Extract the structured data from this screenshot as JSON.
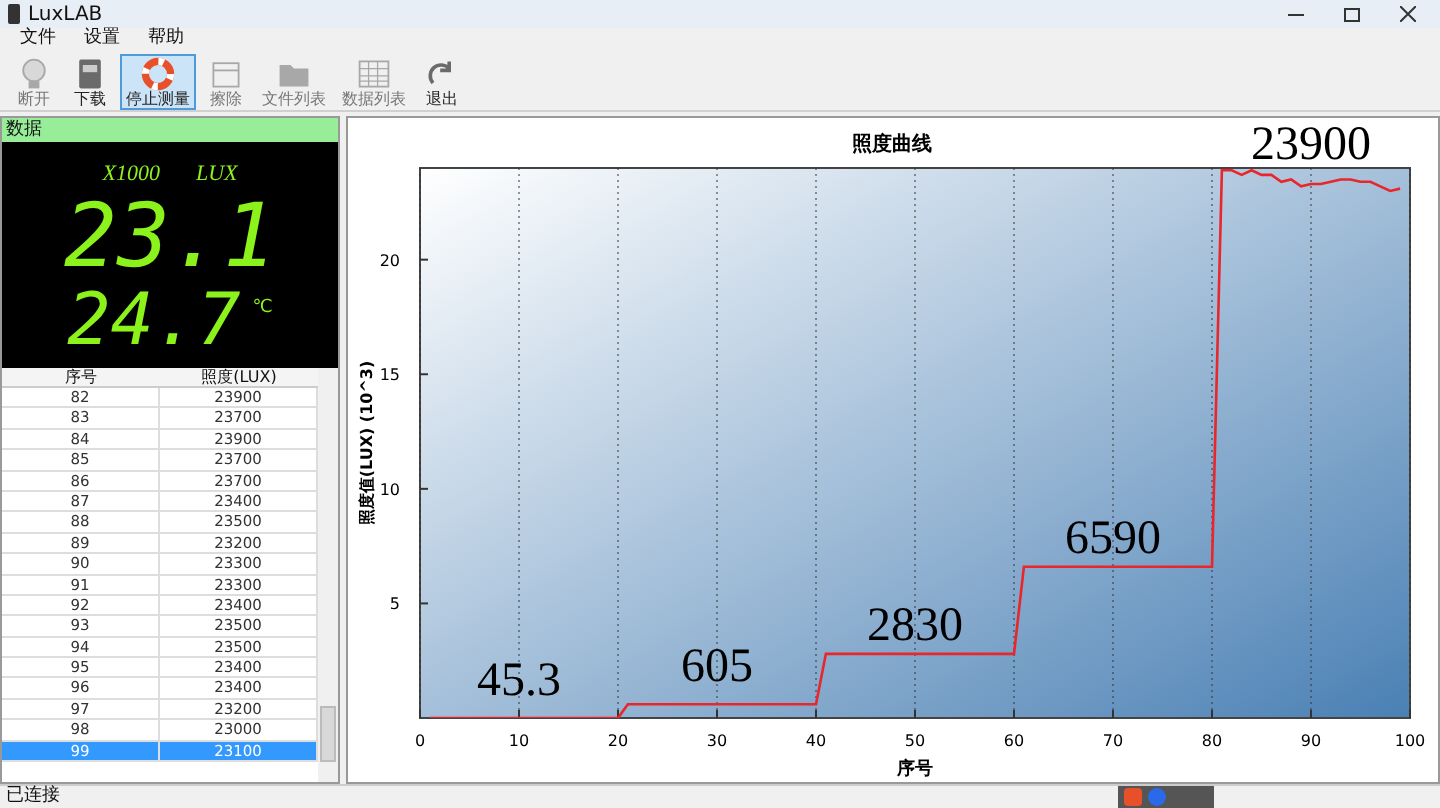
{
  "window": {
    "title": "LuxLAB"
  },
  "menu": [
    "文件",
    "设置",
    "帮助"
  ],
  "toolbar": [
    {
      "label": "断开",
      "kind": "bulb",
      "disabled": true,
      "selected": false
    },
    {
      "label": "下载",
      "kind": "book",
      "disabled": false,
      "selected": false
    },
    {
      "label": "停止测量",
      "kind": "lifebuoy",
      "disabled": false,
      "selected": true
    },
    {
      "label": "擦除",
      "kind": "eraser",
      "disabled": true,
      "selected": false
    },
    {
      "label": "文件列表",
      "kind": "folder",
      "disabled": true,
      "selected": false
    },
    {
      "label": "数据列表",
      "kind": "grid",
      "disabled": true,
      "selected": false
    },
    {
      "label": "退出",
      "kind": "redo",
      "disabled": false,
      "selected": false
    }
  ],
  "data_panel": {
    "title": "数据",
    "multiplier": "X1000",
    "unit": "LUX",
    "illuminance": "23.1",
    "temperature": "24.7",
    "temp_unit": "℃"
  },
  "table": {
    "columns": [
      "序号",
      "照度(LUX)"
    ],
    "rows": [
      {
        "cells": [
          "82",
          "23900"
        ],
        "selected": false
      },
      {
        "cells": [
          "83",
          "23700"
        ],
        "selected": false
      },
      {
        "cells": [
          "84",
          "23900"
        ],
        "selected": false
      },
      {
        "cells": [
          "85",
          "23700"
        ],
        "selected": false
      },
      {
        "cells": [
          "86",
          "23700"
        ],
        "selected": false
      },
      {
        "cells": [
          "87",
          "23400"
        ],
        "selected": false
      },
      {
        "cells": [
          "88",
          "23500"
        ],
        "selected": false
      },
      {
        "cells": [
          "89",
          "23200"
        ],
        "selected": false
      },
      {
        "cells": [
          "90",
          "23300"
        ],
        "selected": false
      },
      {
        "cells": [
          "91",
          "23300"
        ],
        "selected": false
      },
      {
        "cells": [
          "92",
          "23400"
        ],
        "selected": false
      },
      {
        "cells": [
          "93",
          "23500"
        ],
        "selected": false
      },
      {
        "cells": [
          "94",
          "23500"
        ],
        "selected": false
      },
      {
        "cells": [
          "95",
          "23400"
        ],
        "selected": false
      },
      {
        "cells": [
          "96",
          "23400"
        ],
        "selected": false
      },
      {
        "cells": [
          "97",
          "23200"
        ],
        "selected": false
      },
      {
        "cells": [
          "98",
          "23000"
        ],
        "selected": false
      },
      {
        "cells": [
          "99",
          "23100"
        ],
        "selected": true
      }
    ]
  },
  "chart": {
    "chart_data": {
      "type": "line",
      "title": "照度曲线",
      "xlabel": "序号",
      "ylabel": "照度值(LUX)  (10^3)",
      "x": [
        1,
        2,
        3,
        4,
        5,
        6,
        7,
        8,
        9,
        10,
        11,
        12,
        13,
        14,
        15,
        16,
        17,
        18,
        19,
        20,
        21,
        22,
        23,
        24,
        25,
        26,
        27,
        28,
        29,
        30,
        31,
        32,
        33,
        34,
        35,
        36,
        37,
        38,
        39,
        40,
        41,
        42,
        43,
        44,
        45,
        46,
        47,
        48,
        49,
        50,
        51,
        52,
        53,
        54,
        55,
        56,
        57,
        58,
        59,
        60,
        61,
        62,
        63,
        64,
        65,
        66,
        67,
        68,
        69,
        70,
        71,
        72,
        73,
        74,
        75,
        76,
        77,
        78,
        79,
        80,
        81,
        82,
        83,
        84,
        85,
        86,
        87,
        88,
        89,
        90,
        91,
        92,
        93,
        94,
        95,
        96,
        97,
        98,
        99
      ],
      "series": [
        {
          "color": "#e8262b",
          "values": [
            0,
            0,
            0,
            0,
            0,
            0,
            0,
            0,
            0,
            0,
            0,
            0,
            0,
            0,
            0,
            0,
            0,
            0,
            0,
            0,
            0.6,
            0.6,
            0.6,
            0.6,
            0.6,
            0.6,
            0.6,
            0.6,
            0.6,
            0.6,
            0.6,
            0.6,
            0.6,
            0.6,
            0.6,
            0.6,
            0.6,
            0.6,
            0.6,
            0.6,
            2.8,
            2.8,
            2.8,
            2.8,
            2.8,
            2.8,
            2.8,
            2.8,
            2.8,
            2.8,
            2.8,
            2.8,
            2.8,
            2.8,
            2.8,
            2.8,
            2.8,
            2.8,
            2.8,
            2.8,
            6.6,
            6.6,
            6.6,
            6.6,
            6.6,
            6.6,
            6.6,
            6.6,
            6.6,
            6.6,
            6.6,
            6.6,
            6.6,
            6.6,
            6.6,
            6.6,
            6.6,
            6.6,
            6.6,
            6.6,
            23.9,
            23.9,
            23.7,
            23.9,
            23.7,
            23.7,
            23.4,
            23.5,
            23.2,
            23.3,
            23.3,
            23.4,
            23.5,
            23.5,
            23.4,
            23.4,
            23.2,
            23.0,
            23.1
          ]
        }
      ],
      "grid": true,
      "xlim": [
        0,
        100
      ],
      "ylim": [
        0,
        24
      ],
      "xticks": [
        0,
        10,
        20,
        30,
        40,
        50,
        60,
        70,
        80,
        90,
        100
      ],
      "yticks": [
        5,
        10,
        15,
        20
      ],
      "annotations": [
        "45.3",
        "605",
        "2830",
        "6590",
        "23900"
      ]
    }
  },
  "status_bar": {
    "text": "已连接"
  }
}
